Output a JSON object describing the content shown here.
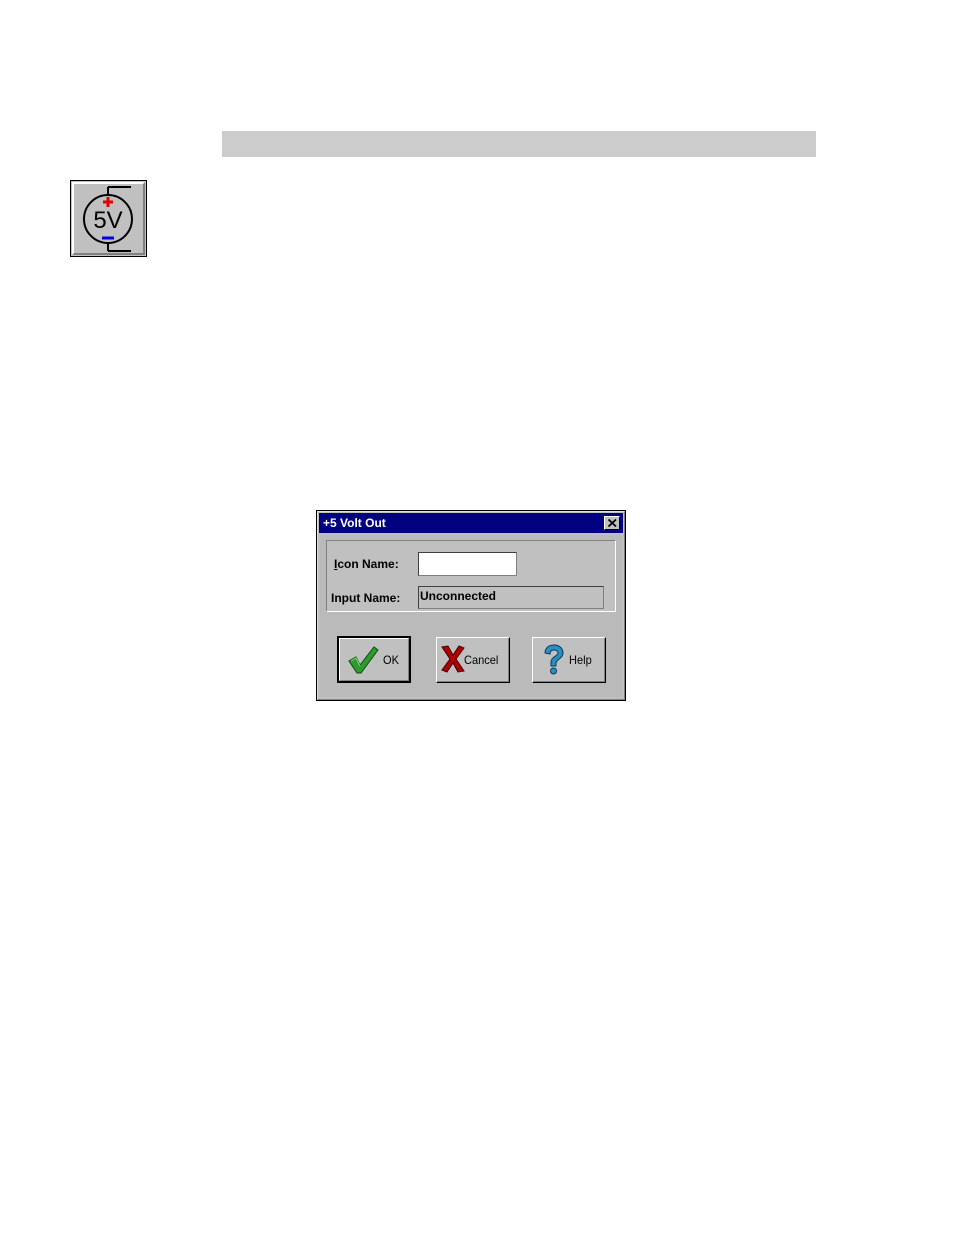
{
  "dialog": {
    "title": "+5 Volt Out",
    "icon_name": {
      "label_accel": "I",
      "label_rest": "con Name:",
      "value": ""
    },
    "input_name": {
      "label": "Input Name:",
      "value": "Unconnected"
    },
    "buttons": {
      "ok": "OK",
      "cancel": "Cancel",
      "help": "Help"
    }
  },
  "tool_icon": {
    "icon": "5v-voltage-source-icon",
    "text": "5V"
  },
  "colors": {
    "title_bar": "#000080",
    "dialog_face": "#c0c0c0",
    "header_bar": "#cccccc",
    "ok_check": "#2e9b2e",
    "cancel_x": "#b00000",
    "help_question": "#2a8fbf"
  }
}
